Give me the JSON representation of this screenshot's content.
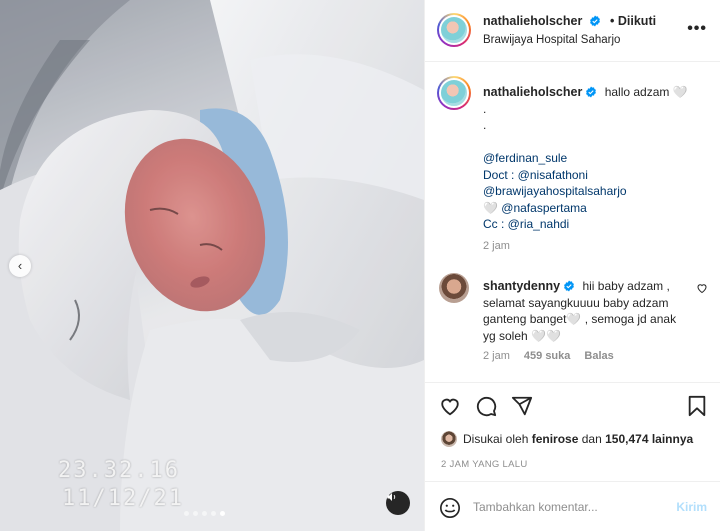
{
  "post": {
    "video_timestamp": "23.32.16",
    "video_date": "11/12/21",
    "carousel_count": 5,
    "carousel_active_index": 4
  },
  "header": {
    "username": "nathalieholscher",
    "follow_status": "• Diikuti",
    "location": "Brawijaya Hospital Saharjo",
    "more_icon": "more-horizontal-icon"
  },
  "caption": {
    "username": "nathalieholscher",
    "lines": [
      "hallo adzam 🤍",
      ".",
      ".",
      "",
      "@ferdinan_sule",
      "Doct : @nisafathoni",
      "@brawijayahospitalsaharjo",
      "🤍 @nafaspertama",
      "Cc : @ria_nahdi"
    ],
    "time": "2 jam"
  },
  "comment": {
    "username": "shantydenny",
    "text": "hii baby adzam , selamat sayangkuuuu baby adzam ganteng banget🤍 , semoga jd anak yg soleh 🤍🤍",
    "time": "2 jam",
    "likes": "459 suka",
    "reply": "Balas"
  },
  "likes": {
    "prefix": "Disukai oleh",
    "user": "fenirose",
    "connector": "dan",
    "count": "150,474 lainnya"
  },
  "post_time": "2 JAM YANG LALU",
  "add_comment": {
    "placeholder": "Tambahkan komentar...",
    "submit": "Kirim"
  },
  "colors": {
    "verified": "#0095f6",
    "link": "#00376b",
    "muted": "#8e8e8e",
    "post_button_disabled": "#b2dffc"
  }
}
